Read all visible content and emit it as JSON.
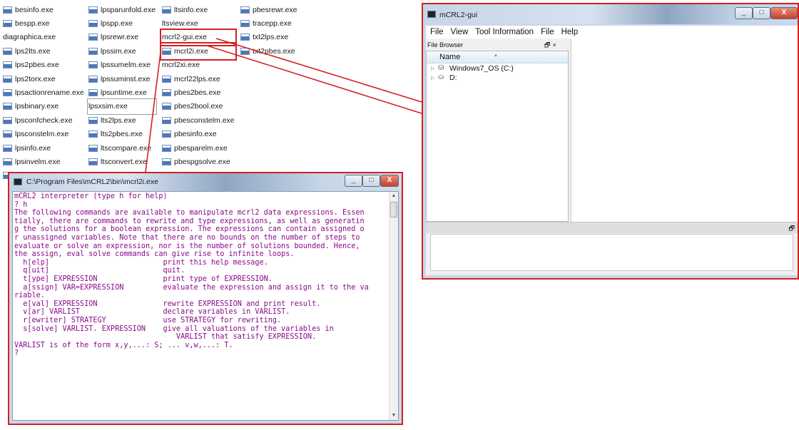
{
  "files": {
    "col1": [
      "besinfo.exe",
      "bespp.exe",
      "diagraphica.exe",
      "lps2lts.exe",
      "lps2pbes.exe",
      "lps2torx.exe",
      "lpsactionrename.exe",
      "lpsbinary.exe",
      "lpsconfcheck.exe",
      "lpsconstelm.exe",
      "lpsinfo.exe",
      "lpsinvelm.exe",
      "lpsparelm.exe"
    ],
    "col2": [
      "lpsparunfold.exe",
      "lpspp.exe",
      "lpsrewr.exe",
      "lpssim.exe",
      "lpssumelm.exe",
      "lpssuminst.exe",
      "lpsuntime.exe",
      "lpsxsim.exe",
      "lts2lps.exe",
      "lts2pbes.exe",
      "ltscompare.exe",
      "ltsconvert.exe",
      "ltsgraph.exe"
    ],
    "col3": [
      "ltsinfo.exe",
      "ltsview.exe",
      "mcrl2-gui.exe",
      "mcrl2i.exe",
      "mcrl2xi.exe",
      "mcrl22lps.exe",
      "pbes2bes.exe",
      "pbes2bool.exe",
      "pbesconstelm.exe",
      "pbesinfo.exe",
      "pbesparelm.exe",
      "pbespgsolve.exe",
      "pbespp.exe"
    ],
    "col4": [
      "pbesrewr.exe",
      "tracepp.exe",
      "txt2lps.exe",
      "txt2pbes.exe"
    ],
    "gui_apps": [
      "diagraphica.exe",
      "lpsxsim.exe",
      "ltsgraph.exe",
      "ltsview.exe",
      "mcrl2-gui.exe",
      "mcrl2xi.exe"
    ],
    "highlighted": [
      "mcrl2-gui.exe",
      "mcrl2i.exe"
    ],
    "selected": "lpsxsim.exe"
  },
  "terminal": {
    "title": "C:\\Program Files\\mCRL2\\bin\\mcrl2i.exe",
    "content": "mCRL2 interpreter (type h for help)\n? h\nThe following commands are available to manipulate mcrl2 data expressions. Essen\ntially, there are commands to rewrite and type expressions, as well as generatin\ng the solutions for a boolean expression. The expressions can contain assigned o\nr unassigned variables. Note that there are no bounds on the number of steps to\nevaluate or solve an expression, nor is the number of solutions bounded. Hence,\nthe assign, eval solve commands can give rise to infinite loops.\n  h[elp]                          print this help message.\n  q[uit]                          quit.\n  t[ype] EXPRESSION               print type of EXPRESSION.\n  a[ssign] VAR=EXPRESSION         evaluate the expression and assign it to the va\nriable.\n  e[val] EXPRESSION               rewrite EXPRESSION and print result.\n  v[ar] VARLIST                   declare variables in VARLIST.\n  r[ewriter] STRATEGY             use STRATEGY for rewriting.\n  s[solve] VARLIST. EXPRESSION    give all valuations of the variables in\n                                     VARLIST that satisfy EXPRESSION.\nVARLIST is of the form x,y,...: S; ... v,w,...: T.\n?",
    "color": "#8a0a8a"
  },
  "gui": {
    "title": "mCRL2-gui",
    "menu": [
      "File",
      "View",
      "Tool Information",
      "File",
      "Help"
    ],
    "dock_title": "File Browser",
    "column_header": "Name",
    "drives": [
      "Windows7_OS (C:)",
      "D:"
    ]
  },
  "window_controls": {
    "minimize": "_",
    "maximize": "□",
    "close": "X"
  },
  "colors": {
    "highlight": "#d42020",
    "console_text": "#8a0a8a"
  }
}
